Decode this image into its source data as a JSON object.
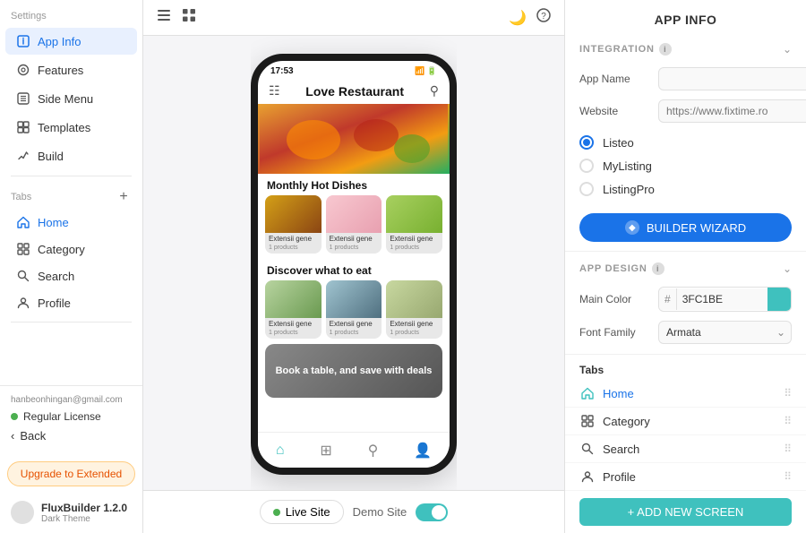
{
  "sidebar": {
    "settings_label": "Settings",
    "items": [
      {
        "id": "app-info",
        "label": "App Info",
        "active": true
      },
      {
        "id": "features",
        "label": "Features",
        "active": false
      },
      {
        "id": "side-menu",
        "label": "Side Menu",
        "active": false
      },
      {
        "id": "templates",
        "label": "Templates",
        "active": false
      },
      {
        "id": "build",
        "label": "Build",
        "active": false
      }
    ],
    "tabs_label": "Tabs",
    "tabs": [
      {
        "id": "home",
        "label": "Home",
        "active": true
      },
      {
        "id": "category",
        "label": "Category",
        "active": false
      },
      {
        "id": "search",
        "label": "Search",
        "active": false
      },
      {
        "id": "profile",
        "label": "Profile",
        "active": false
      }
    ],
    "user_email": "hanbeonhingan@gmail.com",
    "license": "Regular License",
    "back_label": "Back",
    "upgrade_label": "Upgrade to Extended",
    "brand_name": "FluxBuilder 1.2.0",
    "brand_theme": "Dark Theme"
  },
  "phone": {
    "time": "17:53",
    "app_name": "Love Restaurant",
    "section1": "Monthly Hot Dishes",
    "section2": "Discover what to eat",
    "cards": [
      {
        "label": "Extensii gene",
        "sub": "1 products"
      },
      {
        "label": "Extensii gene",
        "sub": "1 products"
      },
      {
        "label": "Extensii gene",
        "sub": "1 products"
      }
    ],
    "banner_text": "Book a table, and save with deals"
  },
  "center_bottom": {
    "live_site": "Live Site",
    "demo_site": "Demo Site"
  },
  "right_panel": {
    "title": "APP INFO",
    "integration_label": "INTEGRATION",
    "app_name_label": "App Name",
    "app_name_placeholder": "",
    "website_label": "Website",
    "website_placeholder": "https://www.fixtime.ro",
    "radio_options": [
      {
        "id": "listeo",
        "label": "Listeo",
        "selected": true
      },
      {
        "id": "mylisting",
        "label": "MyListing",
        "selected": false
      },
      {
        "id": "listingpro",
        "label": "ListingPro",
        "selected": false
      }
    ],
    "builder_wizard_label": "BUILDER WIZARD",
    "app_design_label": "APP DESIGN",
    "main_color_label": "Main Color",
    "main_color_value": "3FC1BE",
    "font_family_label": "Font Family",
    "font_family_value": "Armata",
    "tabs_label": "Tabs",
    "tabs": [
      {
        "id": "home",
        "label": "Home",
        "active": true
      },
      {
        "id": "category",
        "label": "Category"
      },
      {
        "id": "search",
        "label": "Search"
      },
      {
        "id": "profile",
        "label": "Profile"
      }
    ],
    "add_screen_label": "+ ADD NEW SCREEN"
  }
}
